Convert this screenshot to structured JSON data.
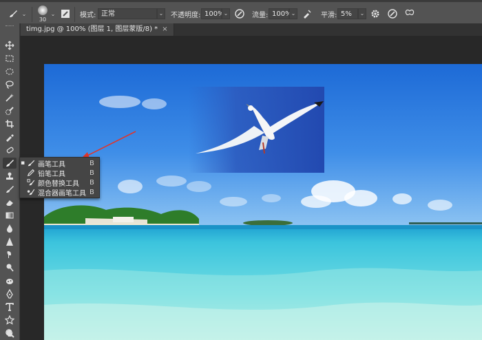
{
  "options_bar": {
    "brush_size": "30",
    "mode_label": "模式:",
    "mode_value": "正常",
    "opacity_label": "不透明度:",
    "opacity_value": "100%",
    "flow_label": "流量:",
    "flow_value": "100%",
    "smoothing_label": "平滑:",
    "smoothing_value": "5%"
  },
  "document_tab": {
    "title": "timg.jpg @ 100% (图层 1, 图层蒙版/8) *",
    "close": "×"
  },
  "toolbar": {
    "tools": [
      "move-tool",
      "marquee-tool",
      "lasso-tool",
      "quick-select-tool",
      "crop-tool",
      "eyedropper-tool",
      "spot-healing-tool",
      "brush-tool",
      "clone-stamp-tool",
      "history-brush-tool",
      "eraser-tool",
      "gradient-tool",
      "blur-tool",
      "dodge-tool",
      "pen-tool",
      "type-tool",
      "path-select-tool",
      "shape-tool",
      "hand-tool",
      "zoom-tool"
    ]
  },
  "brush_flyout": {
    "items": [
      {
        "label": "画笔工具",
        "key": "B",
        "selected": true,
        "icon": "brush-icon"
      },
      {
        "label": "铅笔工具",
        "key": "B",
        "selected": false,
        "icon": "pencil-icon"
      },
      {
        "label": "颜色替换工具",
        "key": "B",
        "selected": false,
        "icon": "color-replacement-icon"
      },
      {
        "label": "混合器画笔工具",
        "key": "B",
        "selected": false,
        "icon": "mixer-brush-icon"
      }
    ]
  },
  "colors": {
    "ui_panel": "#535353",
    "arrow": "#e0352b",
    "sky": "#2a7de1",
    "sea": "#39c3d6"
  }
}
